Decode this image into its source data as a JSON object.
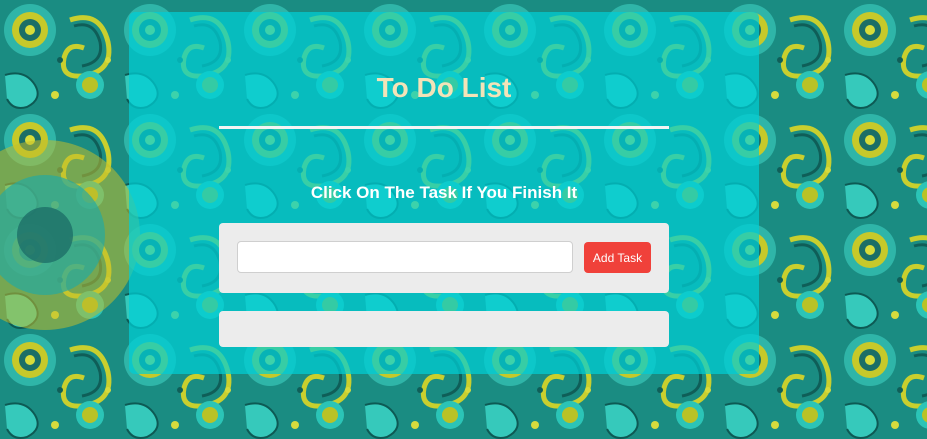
{
  "app": {
    "title": "To Do List",
    "subtitle": "Click On The Task If You Finish It"
  },
  "form": {
    "task_input_value": "",
    "task_input_placeholder": "",
    "add_button_label": "Add Task"
  },
  "tasks": [],
  "colors": {
    "panel": "#00ced6",
    "title": "#f3e3b8",
    "add_button": "#f0413a",
    "box_background": "#ececec"
  },
  "background": {
    "pattern": "paisley-mandala-pattern"
  }
}
